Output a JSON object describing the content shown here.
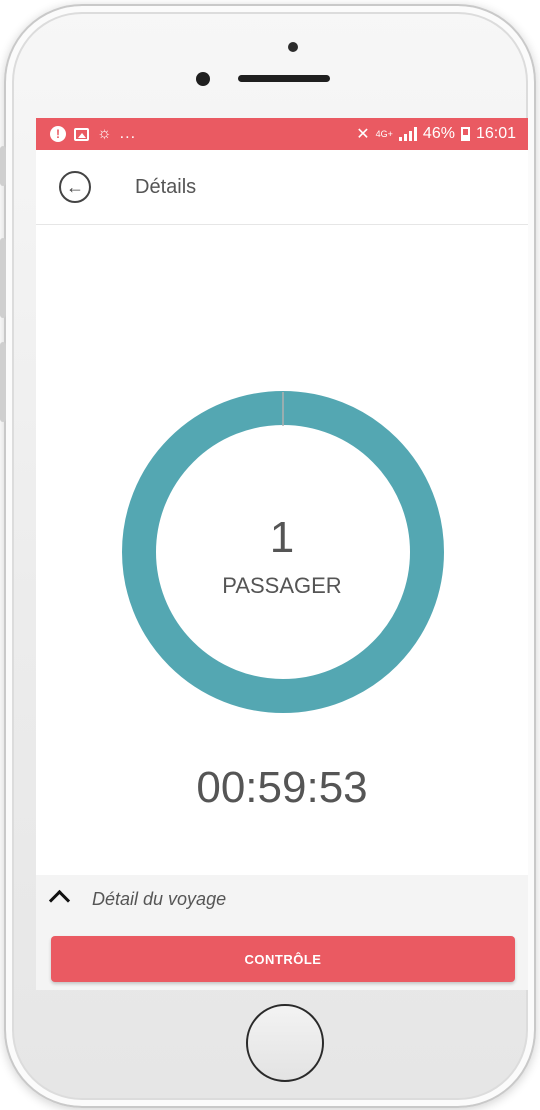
{
  "status_bar": {
    "left_overflow": "...",
    "network": "4G+",
    "battery": "46%",
    "time": "16:01",
    "color": "#ea5a62"
  },
  "header": {
    "title": "Détails",
    "back_icon": "arrow-left-circle-icon"
  },
  "counter": {
    "count": "1",
    "label": "PASSAGER",
    "ring_color": "#54a7b2"
  },
  "timer": "00:59:53",
  "trip_detail": {
    "label": "Détail du voyage",
    "icon": "chevron-up-icon"
  },
  "action_button": {
    "label": "CONTRÔLE",
    "color": "#ea5a62"
  }
}
